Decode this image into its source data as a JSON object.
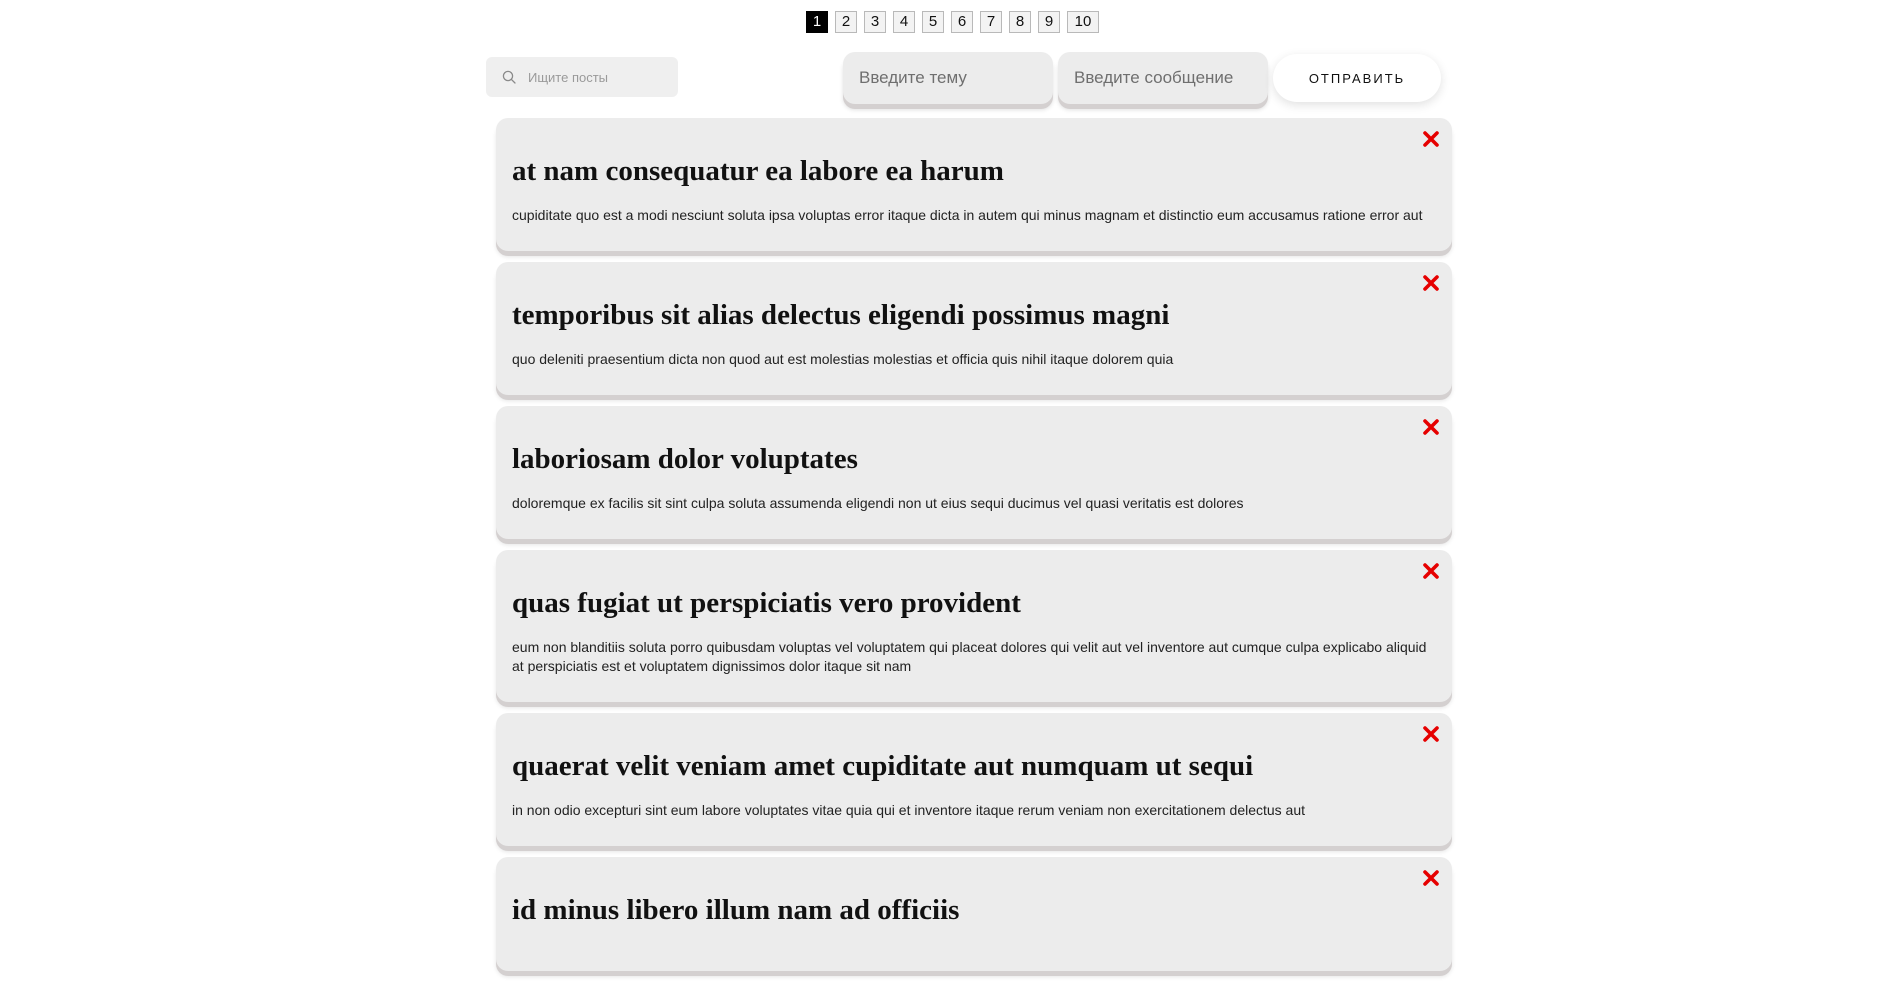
{
  "pagination": {
    "pages": [
      "1",
      "2",
      "3",
      "4",
      "5",
      "6",
      "7",
      "8",
      "9",
      "10"
    ],
    "active": "1"
  },
  "search": {
    "placeholder": "Ищите посты",
    "value": ""
  },
  "form": {
    "topic_placeholder": "Введите тему",
    "message_placeholder": "Введите сообщение",
    "send_label": "ОТПРАВИТЬ"
  },
  "colors": {
    "delete": "#e60000",
    "card": "#ececec",
    "active_page": "#000000"
  },
  "icons": {
    "search": "search-icon",
    "delete": "close-icon"
  },
  "posts": [
    {
      "title": "at nam consequatur ea labore ea harum",
      "body": "cupiditate quo est a modi nesciunt soluta ipsa voluptas error itaque dicta in autem qui minus magnam et distinctio eum accusamus ratione error aut"
    },
    {
      "title": "temporibus sit alias delectus eligendi possimus magni",
      "body": "quo deleniti praesentium dicta non quod aut est molestias molestias et officia quis nihil itaque dolorem quia"
    },
    {
      "title": "laboriosam dolor voluptates",
      "body": "doloremque ex facilis sit sint culpa soluta assumenda eligendi non ut eius sequi ducimus vel quasi veritatis est dolores"
    },
    {
      "title": "quas fugiat ut perspiciatis vero provident",
      "body": "eum non blanditiis soluta porro quibusdam voluptas vel voluptatem qui placeat dolores qui velit aut vel inventore aut cumque culpa explicabo aliquid at perspiciatis est et voluptatem dignissimos dolor itaque sit nam"
    },
    {
      "title": "quaerat velit veniam amet cupiditate aut numquam ut sequi",
      "body": "in non odio excepturi sint eum labore voluptates vitae quia qui et inventore itaque rerum veniam non exercitationem delectus aut"
    },
    {
      "title": "id minus libero illum nam ad officiis",
      "body": ""
    }
  ]
}
